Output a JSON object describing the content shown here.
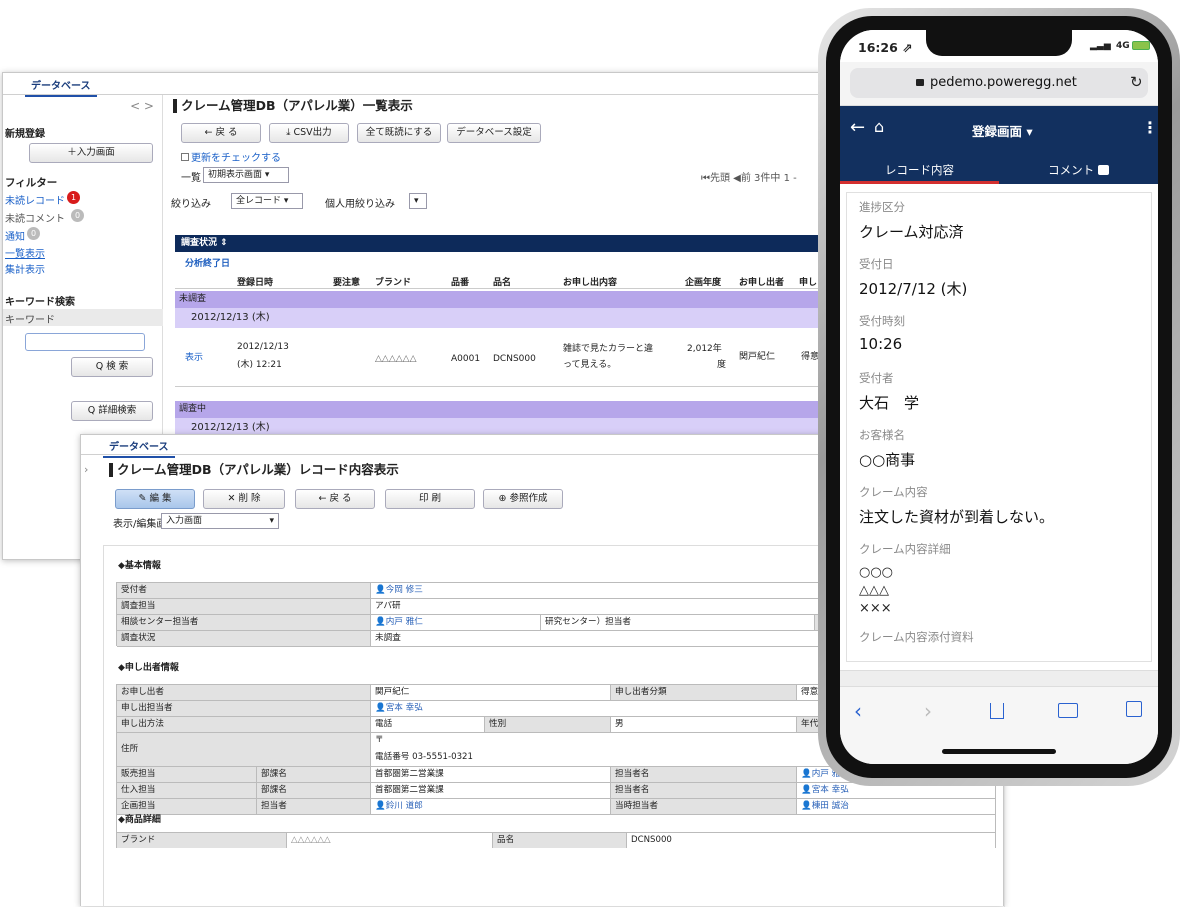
{
  "list": {
    "tab": "データベース",
    "nav": "< >",
    "new_register": "新規登録",
    "input_screen_btn": "＋入力画面",
    "filter": "フィルター",
    "unread_record": "未読レコード",
    "unread_record_count": "1",
    "unread_comment": "未読コメント",
    "unread_comment_count": "0",
    "notify": "通知",
    "notify_count": "0",
    "list_view": "一覧表示",
    "summary_view": "集計表示",
    "keyword_search": "キーワード検索",
    "keyword": "キーワード",
    "search_btn": "Q 検 索",
    "detail_search_btn": "Q 詳細検索",
    "title": "クレーム管理DB（アパレル業）一覧表示",
    "back_btn": "← 戻 る",
    "csv_btn": "⤓ CSV出力",
    "mark_read_btn": "全て既読にする",
    "db_settings_btn": "データベース設定",
    "check_update": "更新をチェックする",
    "list_label": "一覧",
    "initial_view": "初期表示画面",
    "paging": "⏮先頭  ◀前  3件中 1 -",
    "filter_label": "絞り込み",
    "filter_value": "全レコード",
    "personal_filter": "個人用絞り込み",
    "status_header": "調査状況 ⇕",
    "group_label": "分析終了日",
    "columns": [
      "登録日時",
      "要注意",
      "ブランド",
      "品番",
      "品名",
      "お申し出内容",
      "企画年度",
      "お申し出者",
      "申し"
    ],
    "group1": "未調査",
    "date1": "2012/12/13 (木)",
    "show_link": "表示",
    "row": {
      "datetime1": "2012/12/13",
      "datetime2": "(木) 12:21",
      "brand": "△△△△△△",
      "code": "A0001",
      "name": "DCNS000",
      "content1": "雑誌で見たカラーと違",
      "content2": "って見える。",
      "year1": "2,012年",
      "year2": "度",
      "person": "関戸紀仁",
      "extra": "得意"
    },
    "group2": "調査中",
    "date2": "2012/12/13 (木)"
  },
  "record": {
    "tab": "データベース",
    "title": "クレーム管理DB（アパレル業）レコード内容表示",
    "edit_btn": "✎ 編 集",
    "delete_btn": "✕ 削 除",
    "back_btn": "← 戻 る",
    "print_btn": "印 刷",
    "ref_btn": "⊕ 参照作成",
    "view_label": "表示/編集画面",
    "view_value": "入力画面",
    "sec_basic": "◆基本情報",
    "receiver_l": "受付者",
    "receiver_v": "今岡 修三",
    "investigator_l": "調査担当",
    "investigator_v": "アパ研",
    "consult_l": "相談センター担当者",
    "consult_v": "内戸 雅仁",
    "research_l": "研究センター）担当者",
    "status_l": "調査状況",
    "status_v": "未調査",
    "sec_claimant": "◆申し出者情報",
    "claimant_l": "お申し出者",
    "claimant_v": "関戸紀仁",
    "claimant_type_l": "申し出者分類",
    "claimant_type_v": "得意",
    "claim_staff_l": "申し出担当者",
    "claim_staff_v": "宮本 幸弘",
    "method_l": "申し出方法",
    "method_v": "電話",
    "gender_l": "性別",
    "gender_v": "男",
    "age_l": "年代",
    "address_l": "住所",
    "address_v1": "〒",
    "address_v2": "電話番号 03-5551-0321",
    "sales_l": "販売担当",
    "sales_dept_l": "部課名",
    "sales_dept_v": "首都圏第二営業課",
    "sales_person_l": "担当者名",
    "sales_person_v": "内戸 雅仁",
    "stock_l": "仕入担当",
    "stock_dept_l": "部課名",
    "stock_dept_v": "首都圏第二営業課",
    "stock_person_l": "担当者名",
    "stock_person_v": "宮本 幸弘",
    "plan_l": "企画担当",
    "plan_person_l": "担当者",
    "plan_person_v": "鈴川 道郎",
    "plan_current_l": "当時担当者",
    "plan_current_v": "棟田 誠治",
    "sec_product": "◆商品詳細",
    "brand_l": "ブランド",
    "brand_v": "△△△△△△",
    "pname_l": "品名",
    "pname_v": "DCNS000"
  },
  "phone": {
    "time": "16:26 ⇗",
    "signal": "4G",
    "url": "pedemo.poweregg.net",
    "screen_title": "登録画面 ▾",
    "tab_record": "レコード内容",
    "tab_comment": "コメント",
    "fields": [
      {
        "label": "進捗区分",
        "value": "クレーム対応済"
      },
      {
        "label": "受付日",
        "value": "2012/7/12 (木)"
      },
      {
        "label": "受付時刻",
        "value": "10:26"
      },
      {
        "label": "受付者",
        "value": "大石　学"
      },
      {
        "label": "お客様名",
        "value": "○○商事"
      },
      {
        "label": "クレーム内容",
        "value": "注文した資材が到着しない。"
      }
    ],
    "detail_label": "クレーム内容詳細",
    "detail_lines": [
      "○○○",
      "△△△",
      "×××"
    ],
    "attachment_label": "クレーム内容添付資料"
  },
  "colors": {
    "navy": "#0d2a5a",
    "purple_group": "#b6a6ea",
    "purple_date": "#d8cff8",
    "phone_header": "#12305f",
    "tab_underline": "#d32f2f",
    "badge_red": "#d81b1b"
  }
}
